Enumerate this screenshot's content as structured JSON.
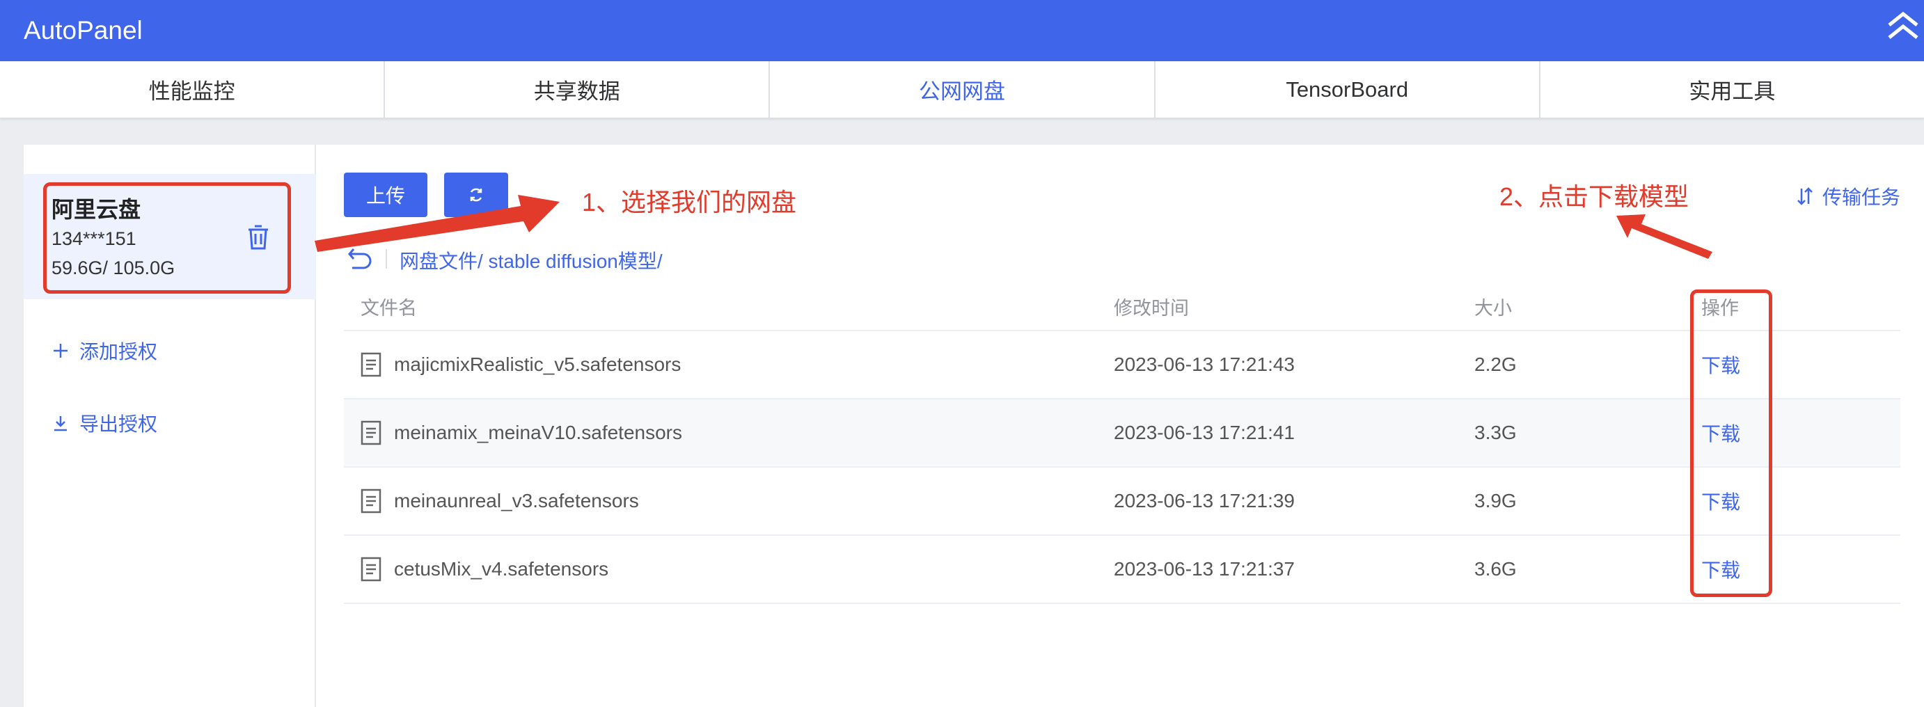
{
  "app": {
    "title": "AutoPanel"
  },
  "tabs": [
    {
      "label": "性能监控"
    },
    {
      "label": "共享数据"
    },
    {
      "label": "公网网盘",
      "active": true
    },
    {
      "label": "TensorBoard"
    },
    {
      "label": "实用工具"
    }
  ],
  "account": {
    "name": "阿里云盘",
    "phone": "134***151",
    "usage": "59.6G/ 105.0G"
  },
  "sidebar": {
    "add_auth": "添加授权",
    "export_auth": "导出授权"
  },
  "toolbar": {
    "upload_label": "上传",
    "transfer_label": "传输任务"
  },
  "breadcrumb": {
    "path": "网盘文件/ stable diffusion模型/"
  },
  "table": {
    "headers": {
      "name": "文件名",
      "time": "修改时间",
      "size": "大小",
      "op": "操作"
    },
    "rows": [
      {
        "name": "majicmixRealistic_v5.safetensors",
        "time": "2023-06-13 17:21:43",
        "size": "2.2G",
        "action": "下载"
      },
      {
        "name": "meinamix_meinaV10.safetensors",
        "time": "2023-06-13 17:21:41",
        "size": "3.3G",
        "action": "下载"
      },
      {
        "name": "meinaunreal_v3.safetensors",
        "time": "2023-06-13 17:21:39",
        "size": "3.9G",
        "action": "下载"
      },
      {
        "name": "cetusMix_v4.safetensors",
        "time": "2023-06-13 17:21:37",
        "size": "3.6G",
        "action": "下载"
      }
    ]
  },
  "annotations": {
    "step1": "1、选择我们的网盘",
    "step2": "2、点击下载模型"
  },
  "colors": {
    "primary": "#3f66ea",
    "annotation": "#e23a2b"
  }
}
